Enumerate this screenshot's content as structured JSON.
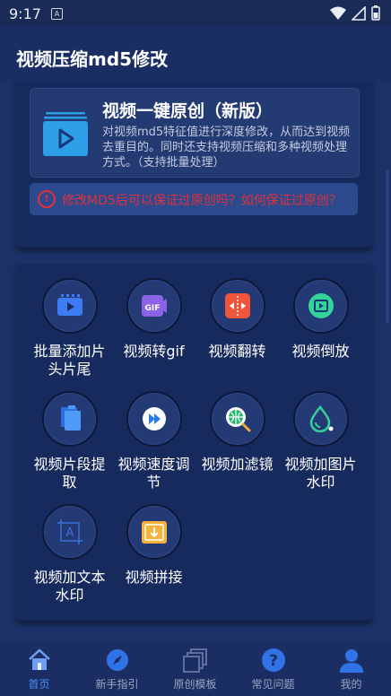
{
  "status_bar": {
    "time": "9:17",
    "notification_icon": "A"
  },
  "app_bar": {
    "title": "视频压缩md5修改"
  },
  "feature_card": {
    "title": "视频一键原创（新版）",
    "description": "对视频md5特征值进行深度修改，从而达到视频去重目的。同时还支持视频压缩和多种视频处理方式。（支持批量处理）",
    "icon": "video-stack-icon"
  },
  "warning": {
    "icon": "alert-circle-icon",
    "text": "修改MD5后可以保证过原创吗？如何保证过原创？",
    "color": "#e0303a"
  },
  "tools": [
    {
      "label": "批量添加片头片尾",
      "icon": "video-play-icon"
    },
    {
      "label": "视频转gif",
      "icon": "gif-icon"
    },
    {
      "label": "视频翻转",
      "icon": "flip-icon"
    },
    {
      "label": "视频倒放",
      "icon": "rewind-play-icon"
    },
    {
      "label": "视频片段提取",
      "icon": "clip-extract-icon"
    },
    {
      "label": "视频速度调节",
      "icon": "speed-icon"
    },
    {
      "label": "视频加滤镜",
      "icon": "filter-globe-icon"
    },
    {
      "label": "视频加图片水印",
      "icon": "image-watermark-icon"
    },
    {
      "label": "视频加文本水印",
      "icon": "text-watermark-icon"
    },
    {
      "label": "视频拼接",
      "icon": "merge-icon"
    }
  ],
  "tab_bar": {
    "items": [
      {
        "label": "首页",
        "icon": "home-icon",
        "active": true
      },
      {
        "label": "新手指引",
        "icon": "compass-icon",
        "active": false
      },
      {
        "label": "原创模板",
        "icon": "template-icon",
        "active": false
      },
      {
        "label": "常见问题",
        "icon": "question-icon",
        "active": false
      },
      {
        "label": "我的",
        "icon": "user-icon",
        "active": false
      }
    ],
    "active_color": "#4d8df5"
  }
}
